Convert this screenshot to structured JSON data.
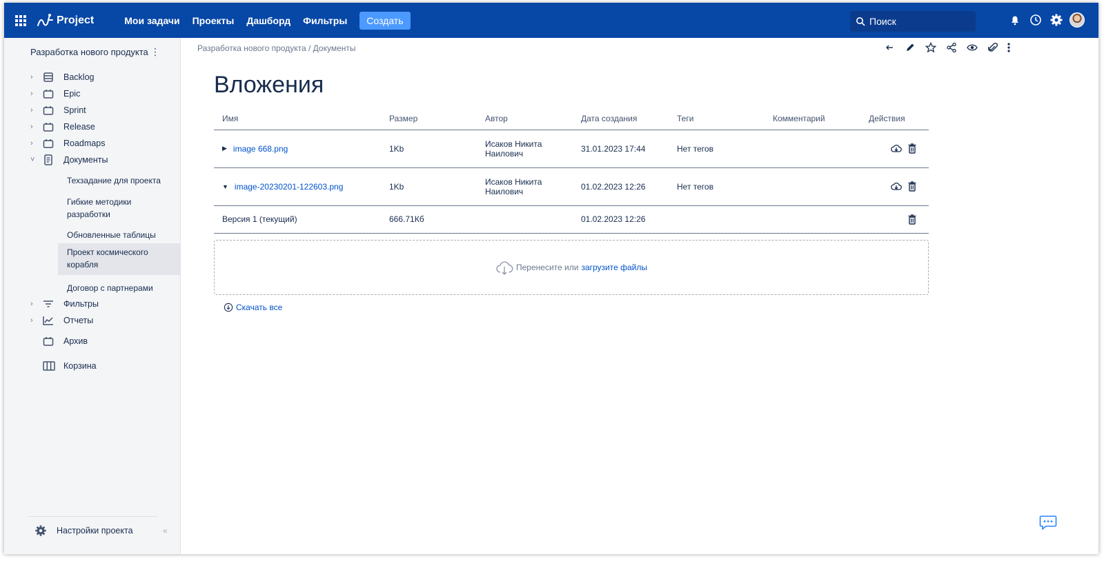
{
  "topbar": {
    "app_name": "Project",
    "nav": [
      "Мои задачи",
      "Проекты",
      "Дашборд",
      "Фильтры"
    ],
    "create_label": "Создать",
    "search_placeholder": "Поиск",
    "accent": "#0747a6"
  },
  "sidebar": {
    "project_title": "Разработка нового продукта",
    "items": [
      {
        "label": "Backlog",
        "icon": "backlog-icon"
      },
      {
        "label": "Epic",
        "icon": "board-icon"
      },
      {
        "label": "Sprint",
        "icon": "board-icon"
      },
      {
        "label": "Release",
        "icon": "board-icon"
      },
      {
        "label": "Roadmaps",
        "icon": "board-icon"
      },
      {
        "label": "Документы",
        "icon": "document-icon"
      }
    ],
    "documents": [
      "Техзадание для проекта",
      "Гибкие методики разработки",
      "Обновленные таблицы",
      "Проект космического корабля",
      "Договор с партнерами"
    ],
    "items_bottom": [
      {
        "label": "Фильтры",
        "icon": "filter-icon"
      },
      {
        "label": "Отчеты",
        "icon": "chart-icon"
      },
      {
        "label": "Архив",
        "icon": "board-icon"
      },
      {
        "label": "Корзина",
        "icon": "columns-icon"
      }
    ],
    "settings_label": "Настройки проекта"
  },
  "breadcrumb": {
    "project": "Разработка нового продукта",
    "separator": "/",
    "page": "Документы"
  },
  "page": {
    "title": "Вложения"
  },
  "table": {
    "headers": [
      "Имя",
      "Размер",
      "Автор",
      "Дата создания",
      "Теги",
      "Комментарий",
      "Действия"
    ],
    "rows": [
      {
        "name": "image 668.png",
        "size": "1Kb",
        "author": "Исаков Никита Наилович",
        "date": "31.01.2023 17:44",
        "tags": "Нет тегов",
        "comment": ""
      },
      {
        "name": "image-20230201-122603.png",
        "size": "1Kb",
        "author": "Исаков Никита Наилович",
        "date": "01.02.2023 12:26",
        "tags": "Нет тегов",
        "comment": ""
      }
    ],
    "version": {
      "name": "Версия 1 (текущий)",
      "size": "666.71Кб",
      "date": "01.02.2023 12:26"
    }
  },
  "dropzone": {
    "text": "Перенесите или",
    "link": "загрузите файлы"
  },
  "download_all": "Скачать все"
}
